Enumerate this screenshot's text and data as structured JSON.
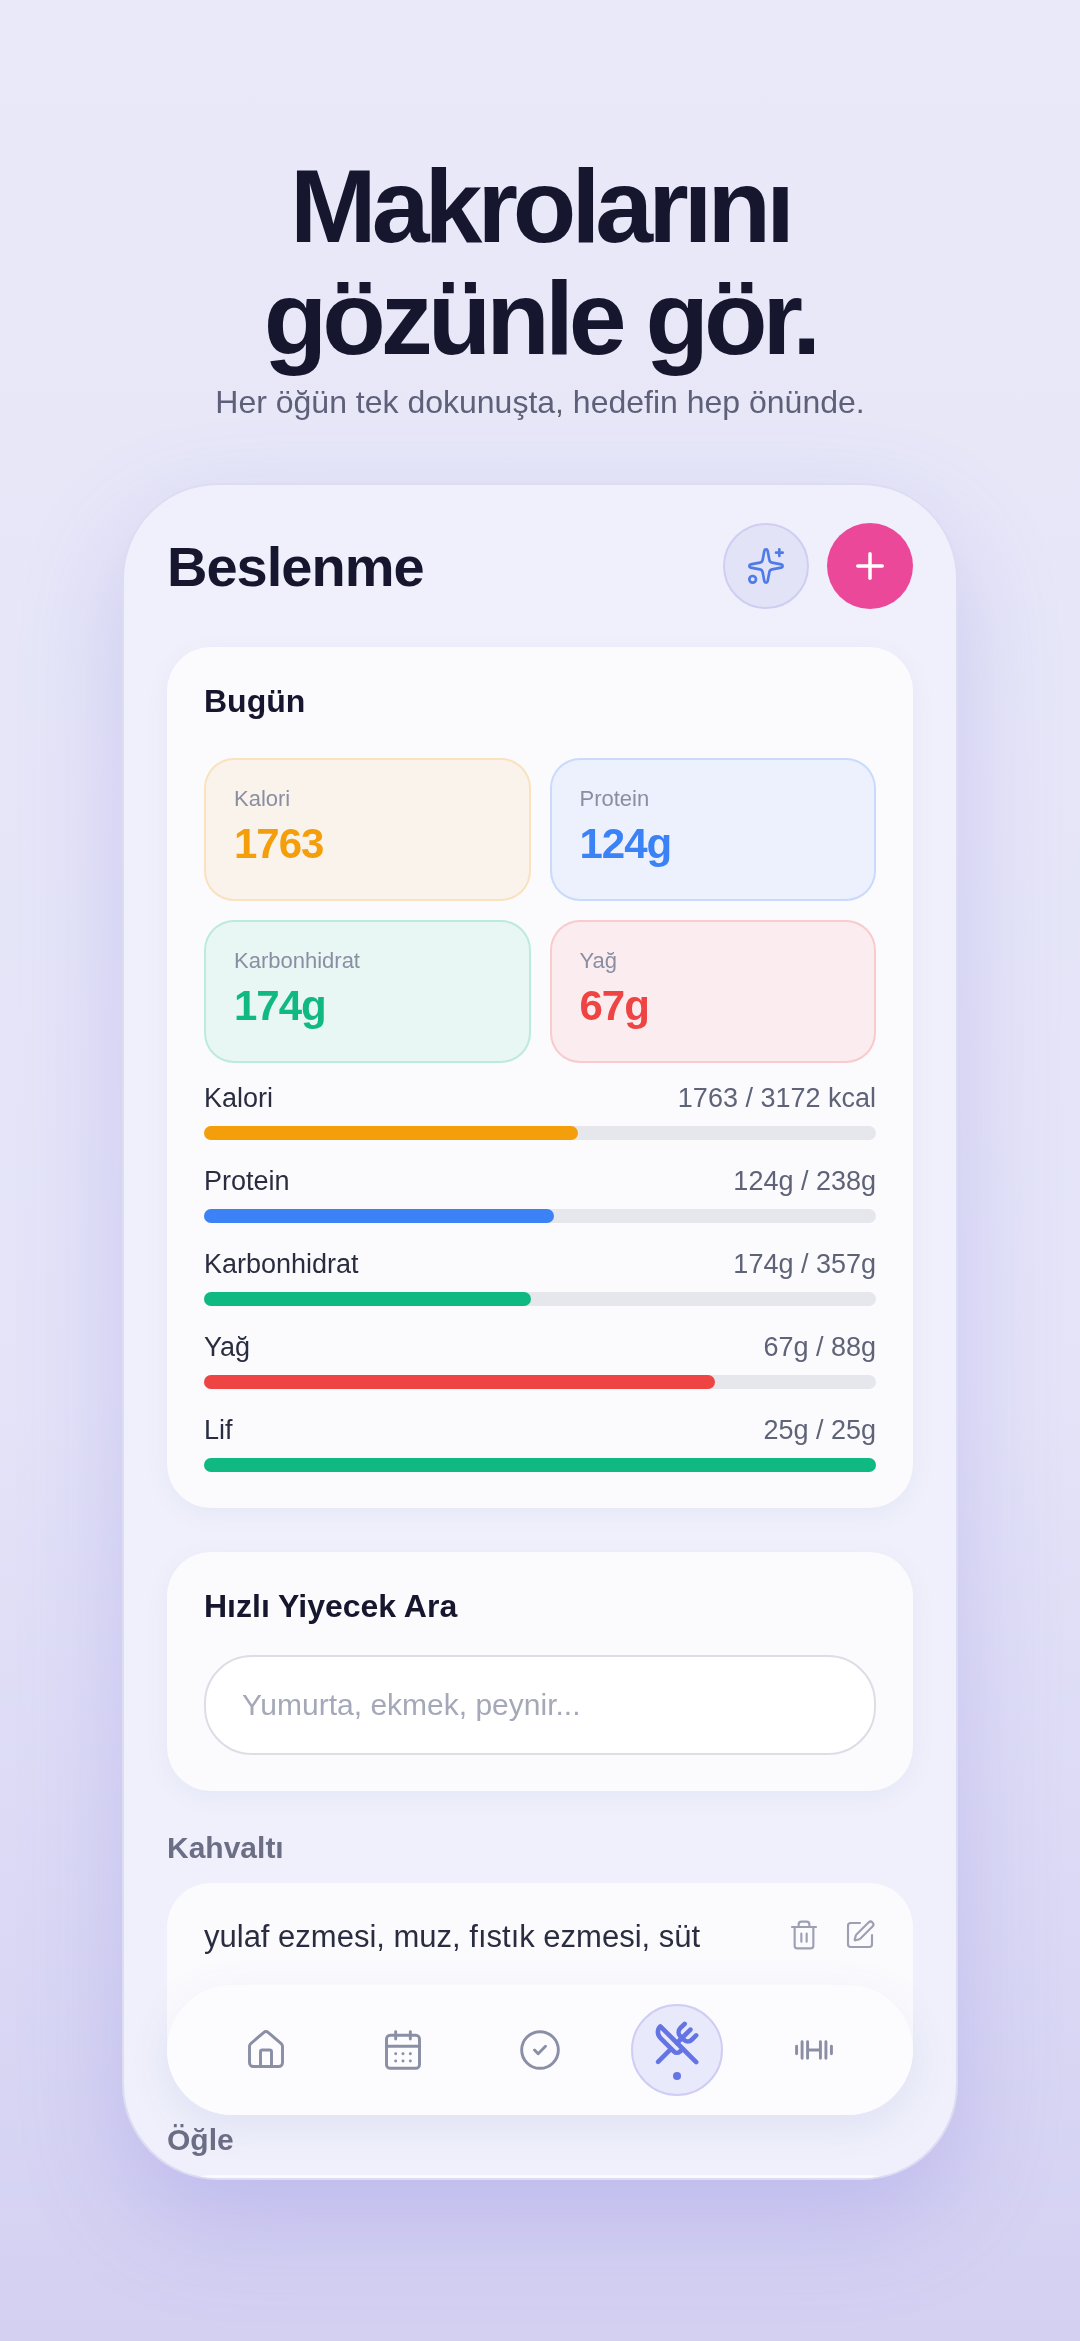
{
  "headline": [
    "Makrolarını",
    "gözünle gör."
  ],
  "subtitle": "Her öğün tek dokunuşta, hedefin hep önünde.",
  "screen": {
    "title": "Beslenme",
    "today": {
      "title": "Bugün",
      "tiles": [
        {
          "label": "Kalori",
          "value": "1763",
          "color": "#f59e0b"
        },
        {
          "label": "Protein",
          "value": "124g",
          "color": "#3b82f6"
        },
        {
          "label": "Karbonhidrat",
          "value": "174g",
          "color": "#10b981"
        },
        {
          "label": "Yağ",
          "value": "67g",
          "color": "#ef4444"
        }
      ],
      "progress": [
        {
          "label": "Kalori",
          "reading": "1763 / 3172 kcal",
          "level": 0.556,
          "color": "#f59e0b"
        },
        {
          "label": "Protein",
          "reading": "124g / 238g",
          "level": 0.521,
          "color": "#3b82f6"
        },
        {
          "label": "Karbonhidrat",
          "reading": "174g / 357g",
          "level": 0.487,
          "color": "#10b981"
        },
        {
          "label": "Yağ",
          "reading": "67g / 88g",
          "level": 0.761,
          "color": "#ef4444"
        },
        {
          "label": "Lif",
          "reading": "25g / 25g",
          "level": 1,
          "color": "#10b981"
        }
      ]
    },
    "search": {
      "title": "Hızlı Yiyecek Ara",
      "placeholder": "Yumurta, ekmek, peynir..."
    },
    "meals": [
      {
        "title": "Kahvaltı",
        "entries": [
          "yulaf ezmesi, muz, fıstık ezmesi, süt"
        ]
      },
      {
        "title": "Öğle"
      }
    ],
    "nav": [
      {
        "kind": "home",
        "selected": false
      },
      {
        "kind": "calendar",
        "selected": false
      },
      {
        "kind": "check",
        "selected": false
      },
      {
        "kind": "food",
        "selected": true
      },
      {
        "kind": "workout",
        "selected": false
      }
    ]
  }
}
